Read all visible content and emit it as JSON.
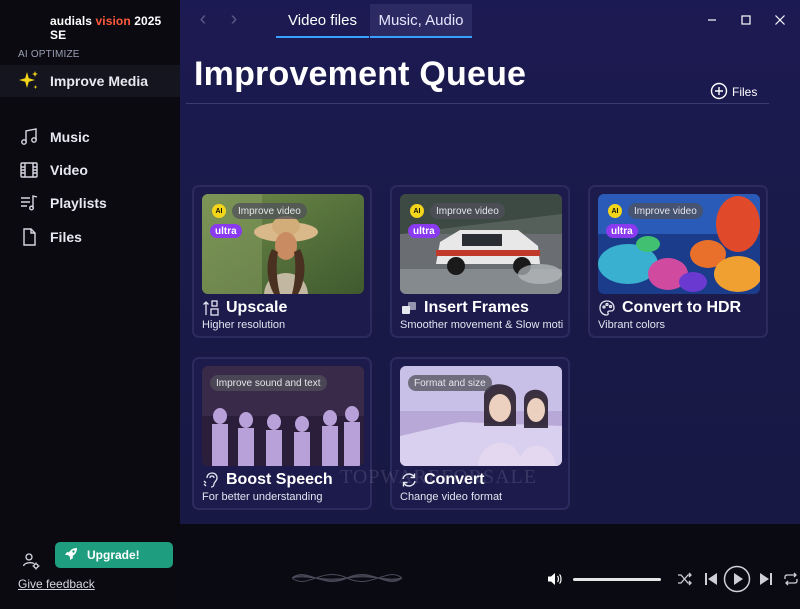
{
  "app": {
    "brand_prefix": "audials ",
    "brand_highlight": "vision",
    "brand_suffix": " 2025 SE"
  },
  "tabs": [
    {
      "label": "Video files"
    },
    {
      "label": "Music, Audio"
    }
  ],
  "sidebar": {
    "section_label": "AI OPTIMIZE",
    "active_item": "Improve Media",
    "items": [
      {
        "label": "Music",
        "icon": "music-icon"
      },
      {
        "label": "Video",
        "icon": "film-icon"
      },
      {
        "label": "Playlists",
        "icon": "playlist-icon"
      },
      {
        "label": "Files",
        "icon": "file-icon"
      }
    ],
    "upgrade_label": "Upgrade!",
    "feedback_label": "Give feedback"
  },
  "main": {
    "title": "Improvement Queue",
    "files_button": "Files",
    "cards": [
      {
        "tag": "Improve video",
        "ai": "AI",
        "ultra": "ultra",
        "title": "Upscale",
        "subtitle": "Higher resolution",
        "icon": "upscale-icon"
      },
      {
        "tag": "Improve video",
        "ai": "AI",
        "ultra": "ultra",
        "title": "Insert Frames",
        "subtitle": "Smoother movement & Slow moti",
        "icon": "frames-icon"
      },
      {
        "tag": "Improve video",
        "ai": "AI",
        "ultra": "ultra",
        "title": "Convert to HDR",
        "subtitle": "Vibrant colors",
        "icon": "palette-icon"
      },
      {
        "tag": "Improve sound and text",
        "title": "Boost Speech",
        "subtitle": "For better understanding",
        "icon": "ear-icon"
      },
      {
        "tag": "Format and size",
        "title": "Convert",
        "subtitle": "Change video format",
        "icon": "convert-icon"
      }
    ],
    "watermark": "TOPWAREFORSALE"
  },
  "colors": {
    "accent": "#38a0ff",
    "brand_highlight": "#ff5a3c",
    "upgrade": "#1f9e7f",
    "ultra": "#8a3bf0",
    "ai_badge": "#f3d51a"
  }
}
